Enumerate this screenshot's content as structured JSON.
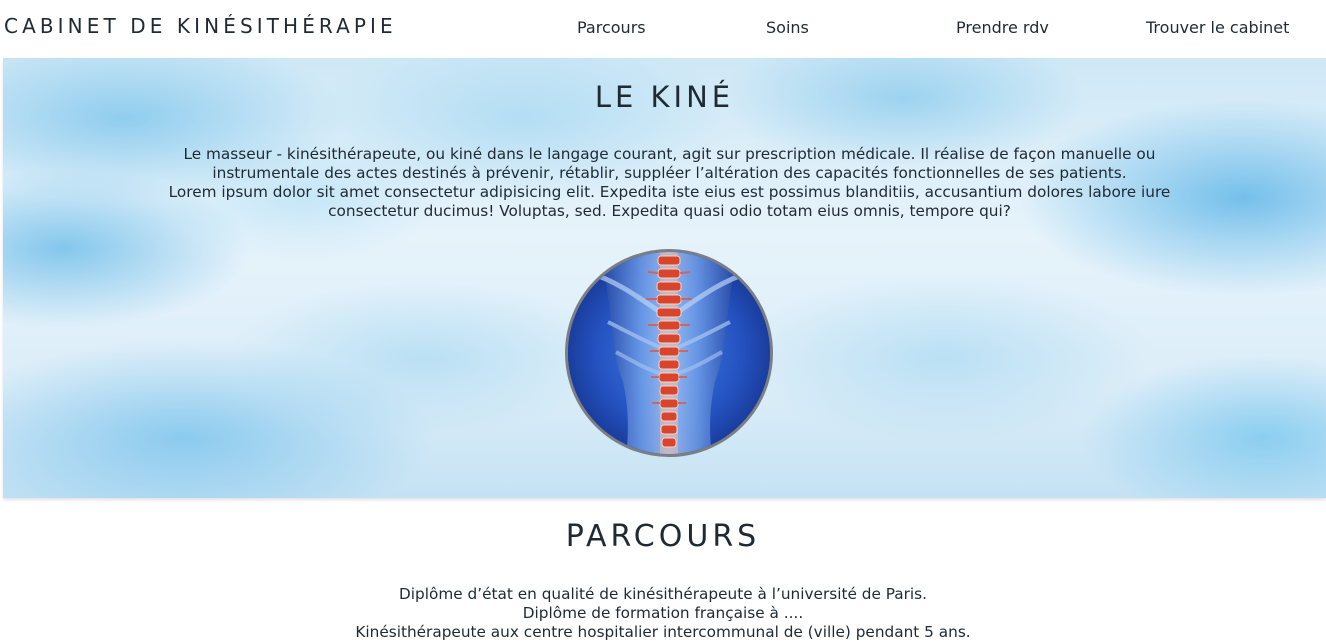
{
  "header": {
    "brand": "CABINET DE KINÉSITHÉRAPIE",
    "nav": [
      {
        "label": "Parcours"
      },
      {
        "label": "Soins"
      },
      {
        "label": "Prendre rdv"
      },
      {
        "label": "Trouver le cabinet"
      }
    ]
  },
  "hero": {
    "title": "LE KINÉ",
    "paragraphs": [
      "Le masseur - kinésithérapeute, ou kiné dans le langage courant, agit sur prescription médicale. Il réalise de façon manuelle ou instrumentale des actes destinés à prévenir, rétablir, suppléer l’altération des capacités fonctionnelles de ses patients.",
      "Lorem ipsum dolor sit amet consectetur adipisicing elit. Expedita iste eius est possimus blanditiis, accusantium dolores labore iure consectetur ducimus! Voluptas, sed. Expedita quasi odio totam eius omnis, tempore qui?"
    ],
    "image_icon": "spine-anatomy-image"
  },
  "parcours": {
    "title": "PARCOURS",
    "lines": [
      "Diplôme d’état en qualité de kinésithérapeute à l’université de Paris.",
      "Diplôme de formation française à ....",
      "Kinésithérapeute aux centre hospitalier intercommunal de (ville) pendant 5 ans."
    ]
  },
  "colors": {
    "text": "#1f2a33",
    "hero_blue": "#6fc0ea",
    "image_frame": "#7a7f86",
    "spine_red": "#d8442c"
  }
}
